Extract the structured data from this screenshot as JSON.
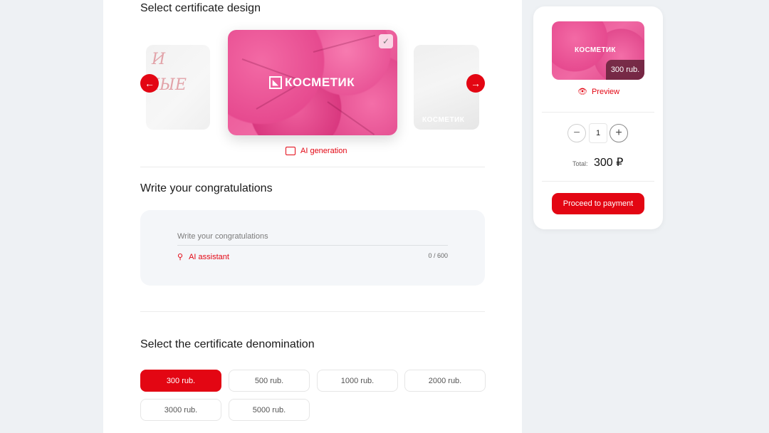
{
  "design": {
    "title": "Select certificate design",
    "brand_name": "КОСМЕТИК",
    "ai_generation_label": "AI generation",
    "left_card_text": [
      "И",
      "НЫЕ"
    ]
  },
  "congrats": {
    "title": "Write your congratulations",
    "placeholder": "Write your congratulations",
    "ai_assistant_label": "AI assistant",
    "counter": "0  / 600"
  },
  "denomination": {
    "title": "Select the certificate denomination",
    "options": [
      "300 rub.",
      "500 rub.",
      "1000 rub.",
      "2000 rub.",
      "3000 rub.",
      "5000 rub."
    ],
    "selected": "300 rub."
  },
  "summary": {
    "card_brand": "КОСМЕТИК",
    "card_price": "300 rub.",
    "preview_label": "Preview",
    "quantity": "1",
    "total_label": "Total:",
    "total_value": "300 ₽",
    "pay_button": "Proceed to payment"
  },
  "colors": {
    "accent": "#e30613",
    "card_pink": "#e84a90",
    "background": "#eef1f4"
  },
  "icons": [
    "arrow-left-icon",
    "arrow-right-icon",
    "check-icon",
    "image-sparkle-icon",
    "magic-wand-icon",
    "eye-icon",
    "minus-icon",
    "plus-icon"
  ]
}
